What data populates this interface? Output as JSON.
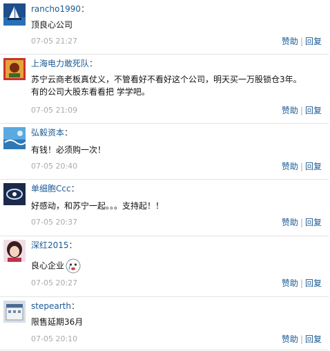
{
  "comments": [
    {
      "username": "rancho1990",
      "content": "顶良心公司",
      "time": "07-05 21:27",
      "avatar": "sailboat-avatar-icon"
    },
    {
      "username": "上海电力敢死队",
      "content_lines": [
        "苏宁云商老板真仗义，不管看好不看好这个公司，明天买一万股锁仓3年。",
        "有的公司大股东看看把 学学吧。"
      ],
      "time": "07-05 21:09",
      "avatar": "poster-avatar-icon"
    },
    {
      "username": "弘毅资本",
      "content": "有钱！必须购一次！",
      "time": "07-05 20:40",
      "avatar": "ocean-avatar-icon"
    },
    {
      "username": "单细胞Ccc",
      "content": "好感动，和苏宁一起。。。支持起！！",
      "time": "07-05 20:37",
      "avatar": "abstract-avatar-icon"
    },
    {
      "username": "深红2015",
      "content": "良心企业",
      "emoji": "crying-face-emoji-icon",
      "time": "07-05 20:27",
      "avatar": "girl-avatar-icon"
    },
    {
      "username": "stepearth",
      "content": "限售延期36月",
      "time": "07-05 20:10",
      "avatar": "building-avatar-icon"
    }
  ],
  "actions": {
    "like": "赞助",
    "reply": "回复",
    "separator": "|",
    "colon": "："
  },
  "colors": {
    "username": "#1a5a94",
    "time": "#aaaaaa",
    "divider": "#e3e3e3"
  }
}
